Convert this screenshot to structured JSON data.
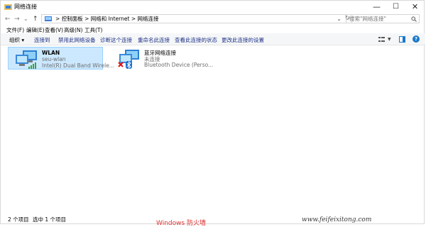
{
  "window": {
    "title": "网络连接"
  },
  "window_controls": {
    "minimize": "—",
    "maximize": "☐",
    "close": "✕"
  },
  "nav": {
    "back": "←",
    "forward": "→",
    "recent": "⌄",
    "up": "↑"
  },
  "address": {
    "crumbs": [
      "控制面板",
      "网络和 Internet",
      "网络连接"
    ],
    "separator": ">",
    "dropdown": "⌄",
    "refresh": "↻"
  },
  "search": {
    "placeholder": "搜索\"网络连接\""
  },
  "menu": [
    "文件(F)",
    "编辑(E)",
    "查看(V)",
    "高级(N)",
    "工具(T)"
  ],
  "toolbar": {
    "organize": "组织 ▾",
    "items": [
      "连接到",
      "禁用此网络设备",
      "诊断这个连接",
      "重命名此连接",
      "查看此连接的状态",
      "更改此连接的设置"
    ],
    "help": "?"
  },
  "connections": [
    {
      "name": "WLAN",
      "line2": "seu-wlan",
      "line3": "Intel(R) Dual Band Wirele...",
      "selected": true,
      "icon": "wifi-adapter-icon"
    },
    {
      "name": "蓝牙网络连接",
      "line2": "未连接",
      "line3": "Bluetooth Device (Perso...",
      "selected": false,
      "icon": "bluetooth-adapter-icon"
    }
  ],
  "status": {
    "count": "2 个项目",
    "selected": "选中 1 个项目"
  },
  "overlay": {
    "red_text": "Windows 防火墙",
    "watermark": "www.feifeixitong.com"
  },
  "colors": {
    "selection": "#cce8ff",
    "toolbar_text": "#1e3287",
    "help": "#1979ca"
  }
}
